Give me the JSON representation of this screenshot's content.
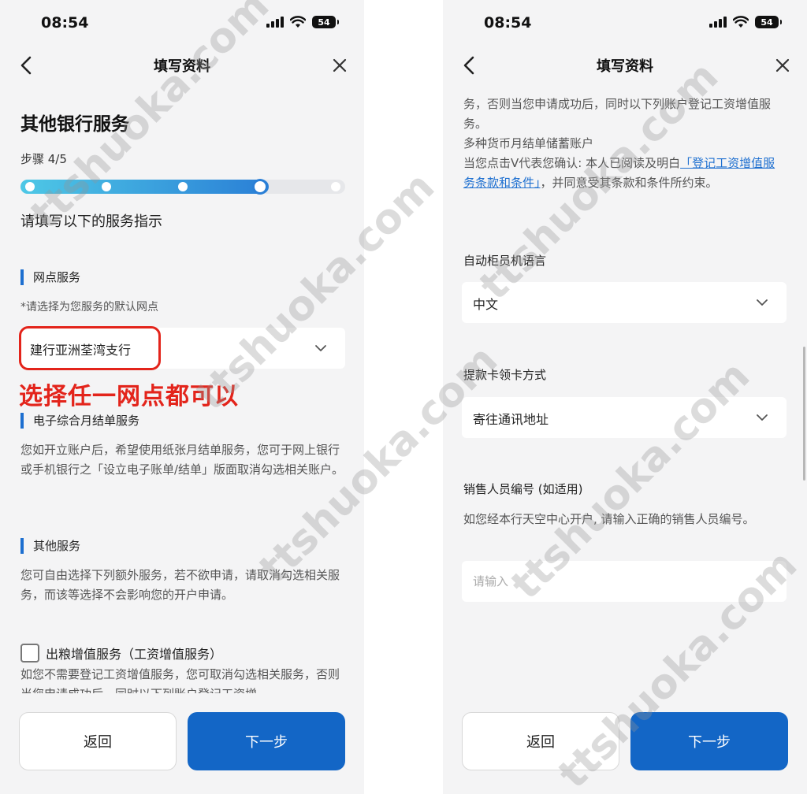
{
  "left": {
    "status": {
      "time": "08:54",
      "battery": "54"
    },
    "nav": {
      "title": "填写资料"
    },
    "heading": "其他银行服务",
    "step": "步骤 4/5",
    "progress": {
      "total_steps": 5,
      "current_step": 4
    },
    "instruction": "请填写以下的服务指示",
    "branch": {
      "title": "网点服务",
      "hint": "*请选择为您服务的默认网点",
      "selected": "建行亚洲荃湾支行"
    },
    "annotation": "选择任一网点都可以",
    "estatement": {
      "title": "电子综合月结单服务",
      "desc": "您如开立账户后，希望使用纸张月结单服务，您可于网上银行或手机银行之「设立电子账单/结单」版面取消勾选相关账户。"
    },
    "other": {
      "title": "其他服务",
      "desc": "您可自由选择下列额外服务，若不欲申请，请取消勾选相关服务，而该等选择不会影响您的开户申请。"
    },
    "payroll": {
      "label": "出粮增值服务（工资增值服务）",
      "desc": "如您不需要登记工资增值服务，您可取消勾选相关服务，否则当您申请成功后，同时以下列账户登记工资增"
    },
    "buttons": {
      "back": "返回",
      "next": "下一步"
    }
  },
  "right": {
    "status": {
      "time": "08:54",
      "battery": "54"
    },
    "nav": {
      "title": "填写资料"
    },
    "payroll_cont": {
      "line1": "务，否则当您申请成功后，同时以下列账户登记工资增值服务。",
      "line2": "多种货币月结单储蓄账户",
      "confirm_prefix": "当您点击V代表您确认: 本人已阅读及明白",
      "confirm_link": "「登记工资增值服务条款和条件」",
      "confirm_suffix": "，并同意受其条款和条件所约束。"
    },
    "atm_language": {
      "title": "自动柜员机语言",
      "selected": "中文"
    },
    "card_collection": {
      "title": "提款卡领卡方式",
      "selected": "寄往通讯地址"
    },
    "sales_id": {
      "title": "销售人员编号 (如适用)",
      "hint": "如您经本行天空中心开户, 请输入正确的销售人员编号。",
      "placeholder": "请输入"
    },
    "buttons": {
      "back": "返回",
      "next": "下一步"
    }
  },
  "watermark": "ttshuoka.com"
}
